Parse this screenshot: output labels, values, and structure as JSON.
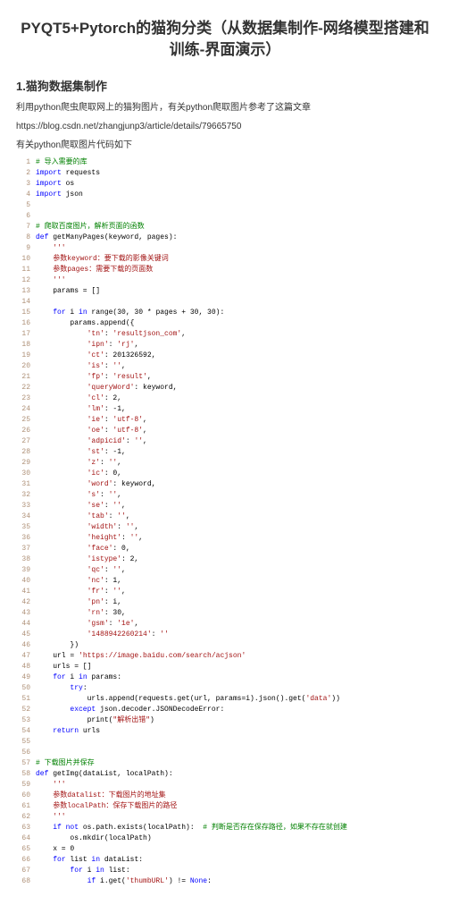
{
  "title": "PYQT5+Pytorch的猫狗分类（从数据集制作-网络模型搭建和训练-界面演示）",
  "section1": "1.猫狗数据集制作",
  "desc1": "利用python爬虫爬取网上的猫狗图片，有关python爬取图片参考了这篇文章",
  "desc2": "https://blog.csdn.net/zhangjunp3/article/details/79665750",
  "desc3": "有关python爬取图片代码如下",
  "code": [
    {
      "n": 1,
      "t": [
        [
          "cmt",
          "# 导入需要的库"
        ]
      ]
    },
    {
      "n": 2,
      "t": [
        [
          "kw",
          "import"
        ],
        [
          "id",
          " requests"
        ]
      ]
    },
    {
      "n": 3,
      "t": [
        [
          "kw",
          "import"
        ],
        [
          "id",
          " os"
        ]
      ]
    },
    {
      "n": 4,
      "t": [
        [
          "kw",
          "import"
        ],
        [
          "id",
          " json"
        ]
      ]
    },
    {
      "n": 5,
      "t": [
        [
          "id",
          ""
        ]
      ]
    },
    {
      "n": 6,
      "t": [
        [
          "id",
          ""
        ]
      ]
    },
    {
      "n": 7,
      "t": [
        [
          "cmt",
          "# 爬取百度图片，解析页面的函数"
        ]
      ]
    },
    {
      "n": 8,
      "t": [
        [
          "kw",
          "def "
        ],
        [
          "fn",
          "getManyPages"
        ],
        [
          "id",
          "(keyword, pages):"
        ]
      ]
    },
    {
      "n": 9,
      "t": [
        [
          "id",
          "    "
        ],
        [
          "str",
          "'''"
        ]
      ]
    },
    {
      "n": 10,
      "t": [
        [
          "str",
          "    参数keyword：要下载的影像关键词"
        ]
      ]
    },
    {
      "n": 11,
      "t": [
        [
          "str",
          "    参数pages：需要下载的页面数"
        ]
      ]
    },
    {
      "n": 12,
      "t": [
        [
          "str",
          "    '''"
        ]
      ]
    },
    {
      "n": 13,
      "t": [
        [
          "id",
          "    params = []"
        ]
      ]
    },
    {
      "n": 14,
      "t": [
        [
          "id",
          ""
        ]
      ]
    },
    {
      "n": 15,
      "t": [
        [
          "id",
          "    "
        ],
        [
          "kw",
          "for"
        ],
        [
          "id",
          " i "
        ],
        [
          "kw",
          "in"
        ],
        [
          "id",
          " range(30, 30 * pages + 30, 30):"
        ]
      ]
    },
    {
      "n": 16,
      "t": [
        [
          "id",
          "        params.append({"
        ]
      ]
    },
    {
      "n": 17,
      "t": [
        [
          "id",
          "            "
        ],
        [
          "str",
          "'tn'"
        ],
        [
          "id",
          ": "
        ],
        [
          "str",
          "'resultjson_com'"
        ],
        [
          "id",
          ","
        ]
      ]
    },
    {
      "n": 18,
      "t": [
        [
          "id",
          "            "
        ],
        [
          "str",
          "'ipn'"
        ],
        [
          "id",
          ": "
        ],
        [
          "str",
          "'rj'"
        ],
        [
          "id",
          ","
        ]
      ]
    },
    {
      "n": 19,
      "t": [
        [
          "id",
          "            "
        ],
        [
          "str",
          "'ct'"
        ],
        [
          "id",
          ": 201326592,"
        ]
      ]
    },
    {
      "n": 20,
      "t": [
        [
          "id",
          "            "
        ],
        [
          "str",
          "'is'"
        ],
        [
          "id",
          ": "
        ],
        [
          "str",
          "''"
        ],
        [
          "id",
          ","
        ]
      ]
    },
    {
      "n": 21,
      "t": [
        [
          "id",
          "            "
        ],
        [
          "str",
          "'fp'"
        ],
        [
          "id",
          ": "
        ],
        [
          "str",
          "'result'"
        ],
        [
          "id",
          ","
        ]
      ]
    },
    {
      "n": 22,
      "t": [
        [
          "id",
          "            "
        ],
        [
          "str",
          "'queryWord'"
        ],
        [
          "id",
          ": keyword,"
        ]
      ]
    },
    {
      "n": 23,
      "t": [
        [
          "id",
          "            "
        ],
        [
          "str",
          "'cl'"
        ],
        [
          "id",
          ": 2,"
        ]
      ]
    },
    {
      "n": 24,
      "t": [
        [
          "id",
          "            "
        ],
        [
          "str",
          "'lm'"
        ],
        [
          "id",
          ": -1,"
        ]
      ]
    },
    {
      "n": 25,
      "t": [
        [
          "id",
          "            "
        ],
        [
          "str",
          "'ie'"
        ],
        [
          "id",
          ": "
        ],
        [
          "str",
          "'utf-8'"
        ],
        [
          "id",
          ","
        ]
      ]
    },
    {
      "n": 26,
      "t": [
        [
          "id",
          "            "
        ],
        [
          "str",
          "'oe'"
        ],
        [
          "id",
          ": "
        ],
        [
          "str",
          "'utf-8'"
        ],
        [
          "id",
          ","
        ]
      ]
    },
    {
      "n": 27,
      "t": [
        [
          "id",
          "            "
        ],
        [
          "str",
          "'adpicid'"
        ],
        [
          "id",
          ": "
        ],
        [
          "str",
          "''"
        ],
        [
          "id",
          ","
        ]
      ]
    },
    {
      "n": 28,
      "t": [
        [
          "id",
          "            "
        ],
        [
          "str",
          "'st'"
        ],
        [
          "id",
          ": -1,"
        ]
      ]
    },
    {
      "n": 29,
      "t": [
        [
          "id",
          "            "
        ],
        [
          "str",
          "'z'"
        ],
        [
          "id",
          ": "
        ],
        [
          "str",
          "''"
        ],
        [
          "id",
          ","
        ]
      ]
    },
    {
      "n": 30,
      "t": [
        [
          "id",
          "            "
        ],
        [
          "str",
          "'ic'"
        ],
        [
          "id",
          ": 0,"
        ]
      ]
    },
    {
      "n": 31,
      "t": [
        [
          "id",
          "            "
        ],
        [
          "str",
          "'word'"
        ],
        [
          "id",
          ": keyword,"
        ]
      ]
    },
    {
      "n": 32,
      "t": [
        [
          "id",
          "            "
        ],
        [
          "str",
          "'s'"
        ],
        [
          "id",
          ": "
        ],
        [
          "str",
          "''"
        ],
        [
          "id",
          ","
        ]
      ]
    },
    {
      "n": 33,
      "t": [
        [
          "id",
          "            "
        ],
        [
          "str",
          "'se'"
        ],
        [
          "id",
          ": "
        ],
        [
          "str",
          "''"
        ],
        [
          "id",
          ","
        ]
      ]
    },
    {
      "n": 34,
      "t": [
        [
          "id",
          "            "
        ],
        [
          "str",
          "'tab'"
        ],
        [
          "id",
          ": "
        ],
        [
          "str",
          "''"
        ],
        [
          "id",
          ","
        ]
      ]
    },
    {
      "n": 35,
      "t": [
        [
          "id",
          "            "
        ],
        [
          "str",
          "'width'"
        ],
        [
          "id",
          ": "
        ],
        [
          "str",
          "''"
        ],
        [
          "id",
          ","
        ]
      ]
    },
    {
      "n": 36,
      "t": [
        [
          "id",
          "            "
        ],
        [
          "str",
          "'height'"
        ],
        [
          "id",
          ": "
        ],
        [
          "str",
          "''"
        ],
        [
          "id",
          ","
        ]
      ]
    },
    {
      "n": 37,
      "t": [
        [
          "id",
          "            "
        ],
        [
          "str",
          "'face'"
        ],
        [
          "id",
          ": 0,"
        ]
      ]
    },
    {
      "n": 38,
      "t": [
        [
          "id",
          "            "
        ],
        [
          "str",
          "'istype'"
        ],
        [
          "id",
          ": 2,"
        ]
      ]
    },
    {
      "n": 39,
      "t": [
        [
          "id",
          "            "
        ],
        [
          "str",
          "'qc'"
        ],
        [
          "id",
          ": "
        ],
        [
          "str",
          "''"
        ],
        [
          "id",
          ","
        ]
      ]
    },
    {
      "n": 40,
      "t": [
        [
          "id",
          "            "
        ],
        [
          "str",
          "'nc'"
        ],
        [
          "id",
          ": 1,"
        ]
      ]
    },
    {
      "n": 41,
      "t": [
        [
          "id",
          "            "
        ],
        [
          "str",
          "'fr'"
        ],
        [
          "id",
          ": "
        ],
        [
          "str",
          "''"
        ],
        [
          "id",
          ","
        ]
      ]
    },
    {
      "n": 42,
      "t": [
        [
          "id",
          "            "
        ],
        [
          "str",
          "'pn'"
        ],
        [
          "id",
          ": i,"
        ]
      ]
    },
    {
      "n": 43,
      "t": [
        [
          "id",
          "            "
        ],
        [
          "str",
          "'rn'"
        ],
        [
          "id",
          ": 30,"
        ]
      ]
    },
    {
      "n": 44,
      "t": [
        [
          "id",
          "            "
        ],
        [
          "str",
          "'gsm'"
        ],
        [
          "id",
          ": "
        ],
        [
          "str",
          "'1e'"
        ],
        [
          "id",
          ","
        ]
      ]
    },
    {
      "n": 45,
      "t": [
        [
          "id",
          "            "
        ],
        [
          "str",
          "'1488942260214'"
        ],
        [
          "id",
          ": "
        ],
        [
          "str",
          "''"
        ]
      ]
    },
    {
      "n": 46,
      "t": [
        [
          "id",
          "        })"
        ]
      ]
    },
    {
      "n": 47,
      "t": [
        [
          "id",
          "    url = "
        ],
        [
          "str",
          "'https://image.baidu.com/search/acjson'"
        ]
      ]
    },
    {
      "n": 48,
      "t": [
        [
          "id",
          "    urls = []"
        ]
      ]
    },
    {
      "n": 49,
      "t": [
        [
          "id",
          "    "
        ],
        [
          "kw",
          "for"
        ],
        [
          "id",
          " i "
        ],
        [
          "kw",
          "in"
        ],
        [
          "id",
          " params:"
        ]
      ]
    },
    {
      "n": 50,
      "t": [
        [
          "id",
          "        "
        ],
        [
          "kw",
          "try"
        ],
        [
          "id",
          ":"
        ]
      ]
    },
    {
      "n": 51,
      "t": [
        [
          "id",
          "            urls.append(requests.get(url, params=i).json().get("
        ],
        [
          "str",
          "'data'"
        ],
        [
          "id",
          "))"
        ]
      ]
    },
    {
      "n": 52,
      "t": [
        [
          "id",
          "        "
        ],
        [
          "kw",
          "except"
        ],
        [
          "id",
          " json.decoder.JSONDecodeError:"
        ]
      ]
    },
    {
      "n": 53,
      "t": [
        [
          "id",
          "            print("
        ],
        [
          "str",
          "\"解析出错\""
        ],
        [
          "id",
          ")"
        ]
      ]
    },
    {
      "n": 54,
      "t": [
        [
          "id",
          "    "
        ],
        [
          "kw",
          "return"
        ],
        [
          "id",
          " urls"
        ]
      ]
    },
    {
      "n": 55,
      "t": [
        [
          "id",
          ""
        ]
      ]
    },
    {
      "n": 56,
      "t": [
        [
          "id",
          ""
        ]
      ]
    },
    {
      "n": 57,
      "t": [
        [
          "cmt",
          "# 下载图片并保存"
        ]
      ]
    },
    {
      "n": 58,
      "t": [
        [
          "kw",
          "def "
        ],
        [
          "fn",
          "getImg"
        ],
        [
          "id",
          "(dataList, localPath):"
        ]
      ]
    },
    {
      "n": 59,
      "t": [
        [
          "id",
          "    "
        ],
        [
          "str",
          "'''"
        ]
      ]
    },
    {
      "n": 60,
      "t": [
        [
          "str",
          "    参数datalist：下载图片的地址集"
        ]
      ]
    },
    {
      "n": 61,
      "t": [
        [
          "str",
          "    参数localPath：保存下载图片的路径"
        ]
      ]
    },
    {
      "n": 62,
      "t": [
        [
          "str",
          "    '''"
        ]
      ]
    },
    {
      "n": 63,
      "t": [
        [
          "id",
          "    "
        ],
        [
          "kw",
          "if not"
        ],
        [
          "id",
          " os.path.exists(localPath):  "
        ],
        [
          "cmt",
          "# 判断是否存在保存路径，如果不存在就创建"
        ]
      ]
    },
    {
      "n": 64,
      "t": [
        [
          "id",
          "        os.mkdir(localPath)"
        ]
      ]
    },
    {
      "n": 65,
      "t": [
        [
          "id",
          "    x = 0"
        ]
      ]
    },
    {
      "n": 66,
      "t": [
        [
          "id",
          "    "
        ],
        [
          "kw",
          "for"
        ],
        [
          "id",
          " list "
        ],
        [
          "kw",
          "in"
        ],
        [
          "id",
          " dataList:"
        ]
      ]
    },
    {
      "n": 67,
      "t": [
        [
          "id",
          "        "
        ],
        [
          "kw",
          "for"
        ],
        [
          "id",
          " i "
        ],
        [
          "kw",
          "in"
        ],
        [
          "id",
          " list:"
        ]
      ]
    },
    {
      "n": 68,
      "t": [
        [
          "id",
          "            "
        ],
        [
          "kw",
          "if"
        ],
        [
          "id",
          " i.get("
        ],
        [
          "str",
          "'thumbURL'"
        ],
        [
          "id",
          ") != "
        ],
        [
          "kw",
          "None"
        ],
        [
          "id",
          ":"
        ]
      ]
    }
  ]
}
